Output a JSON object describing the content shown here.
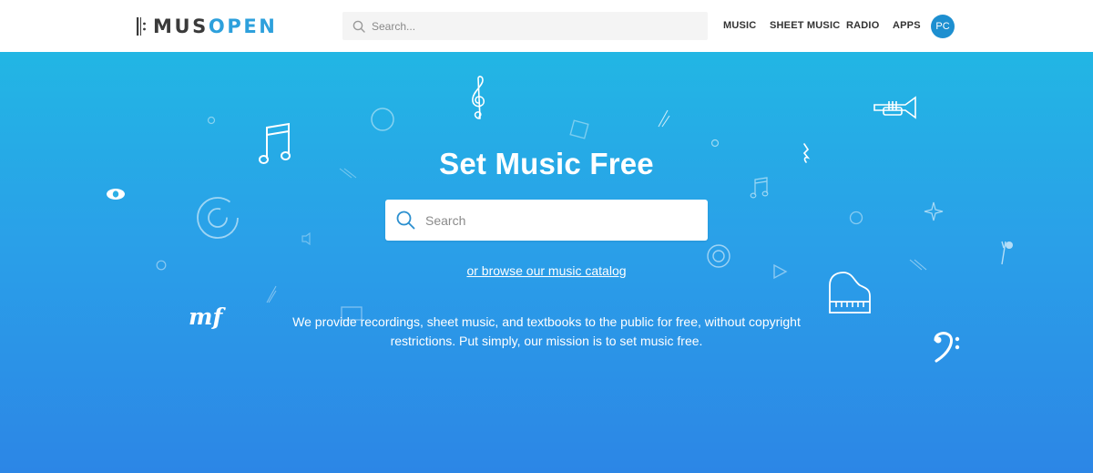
{
  "brand": {
    "name_part1": "MUS",
    "name_part2": "OPEN"
  },
  "header": {
    "search_placeholder": "Search...",
    "nav": [
      {
        "label": "MUSIC"
      },
      {
        "label": "SHEET MUSIC"
      },
      {
        "label": "RADIO"
      },
      {
        "label": "APPS"
      }
    ],
    "avatar_initials": "PC"
  },
  "hero": {
    "title": "Set Music Free",
    "search_placeholder": "Search",
    "browse_link": "or browse our music catalog",
    "mission_line1": "We provide recordings, sheet music, and textbooks to the public for free, without copyright",
    "mission_line2": "restrictions. Put simply, our mission is to set music free.",
    "dynamic_mark": "mf"
  },
  "colors": {
    "brand_dark": "#3a3a3a",
    "brand_blue": "#2da0dc",
    "avatar_bg": "#1d8fd0",
    "hero_top": "#22b6e4",
    "hero_bottom": "#2c86e6"
  },
  "icons": [
    "search-icon",
    "treble-clef-icon",
    "bass-clef-icon",
    "eighth-notes-icon",
    "trumpet-icon",
    "piano-icon",
    "play-icon",
    "sparkle-icon",
    "eye-icon",
    "rest-icon"
  ]
}
